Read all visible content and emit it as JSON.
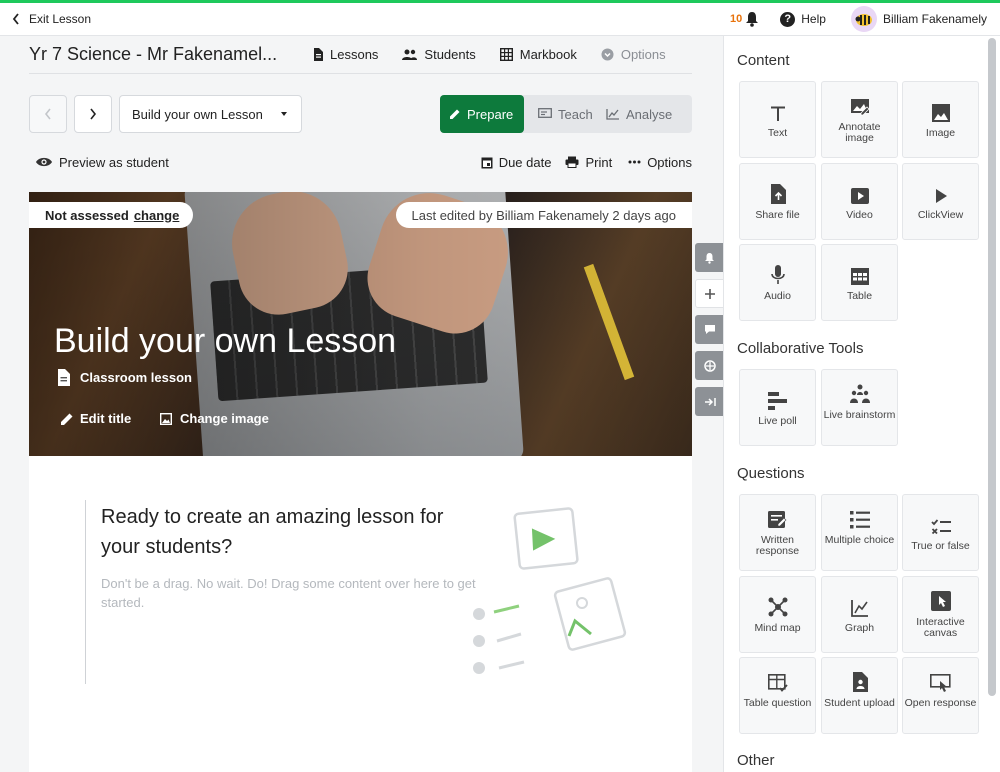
{
  "topbar": {
    "exit_label": "Exit Lesson",
    "notification_count": "10",
    "help_label": "Help",
    "user_name": "Billiam Fakenamely"
  },
  "subnav": {
    "course_title": "Yr 7 Science - Mr Fakenamel...",
    "lessons": "Lessons",
    "students": "Students",
    "markbook": "Markbook",
    "options": "Options"
  },
  "toolbar": {
    "lesson_select": "Build your own Lesson",
    "prepare": "Prepare",
    "teach": "Teach",
    "analyse": "Analyse"
  },
  "actions": {
    "preview": "Preview as student",
    "due_date": "Due date",
    "print": "Print",
    "options": "Options"
  },
  "hero": {
    "assessed_text": "Not assessed",
    "change_link": "change",
    "last_edited": "Last edited by Billiam Fakenamely 2 days ago",
    "title": "Build your own Lesson",
    "subtitle": "Classroom lesson",
    "edit_title": "Edit title",
    "change_image": "Change image"
  },
  "content": {
    "ready_title": "Ready to create an amazing lesson for your students?",
    "ready_desc": "Don't be a drag. No wait. Do! Drag some content over here to get started."
  },
  "panel": {
    "content_title": "Content",
    "content_items": [
      {
        "label": "Text",
        "icon": "text-icon"
      },
      {
        "label": "Annotate image",
        "icon": "annotate-image-icon"
      },
      {
        "label": "Image",
        "icon": "image-icon"
      },
      {
        "label": "Share file",
        "icon": "share-file-icon"
      },
      {
        "label": "Video",
        "icon": "video-icon"
      },
      {
        "label": "ClickView",
        "icon": "clickview-icon"
      },
      {
        "label": "Audio",
        "icon": "microphone-icon"
      },
      {
        "label": "Table",
        "icon": "table-icon"
      }
    ],
    "collab_title": "Collaborative Tools",
    "collab_items": [
      {
        "label": "Live poll",
        "icon": "live-poll-icon"
      },
      {
        "label": "Live brainstorm",
        "icon": "live-brainstorm-icon"
      }
    ],
    "questions_title": "Questions",
    "question_items": [
      {
        "label": "Written response",
        "icon": "written-response-icon"
      },
      {
        "label": "Multiple choice",
        "icon": "multiple-choice-icon"
      },
      {
        "label": "True or false",
        "icon": "true-false-icon"
      },
      {
        "label": "Mind map",
        "icon": "mind-map-icon"
      },
      {
        "label": "Graph",
        "icon": "graph-icon"
      },
      {
        "label": "Interactive canvas",
        "icon": "interactive-canvas-icon"
      },
      {
        "label": "Table question",
        "icon": "table-question-icon"
      },
      {
        "label": "Student upload",
        "icon": "student-upload-icon"
      },
      {
        "label": "Open response",
        "icon": "open-response-icon"
      }
    ],
    "other_title": "Other"
  },
  "colors": {
    "accent_green": "#0d7a3c",
    "top_line": "#1ec95c",
    "notification_orange": "#e8730c"
  }
}
